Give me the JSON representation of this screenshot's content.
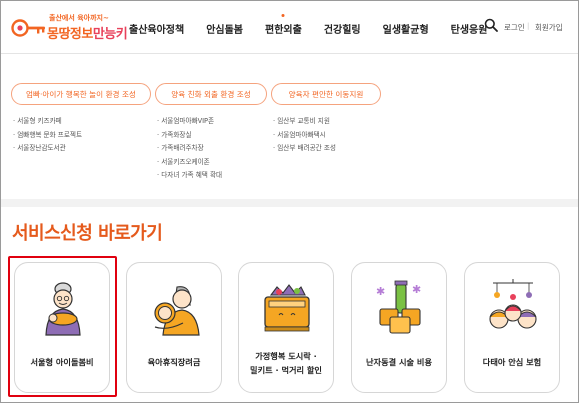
{
  "header": {
    "logo_sub": "출산에서 육아까지~",
    "logo_main_part1": "몽땅정보",
    "logo_main_part2": "만능키",
    "nav": [
      {
        "label": "출산육아정책"
      },
      {
        "label": "안심돌봄"
      },
      {
        "label": "편한외출",
        "active": true
      },
      {
        "label": "건강힐링"
      },
      {
        "label": "일생활균형"
      },
      {
        "label": "탄생응원"
      }
    ],
    "search_icon": "search-icon",
    "login": "로그인",
    "separator": "|",
    "join": "회원가입"
  },
  "mega_menu": {
    "columns": [
      {
        "title": "엄빠·아이가 행복한 놀이 환경 조성",
        "items": [
          "· 서울형 키즈카페",
          "· 엄빠행복 문화 프로젝트",
          "· 서울장난감도서관"
        ]
      },
      {
        "title": "양육 친화 외출 환경 조성",
        "items": [
          "· 서울엄마아빠VIP존",
          "· 가족화장실",
          "· 가족배려주차장",
          "· 서울키즈오케이존",
          "· 다자녀 가족 혜택 확대"
        ]
      },
      {
        "title": "양육자 편안한 이동지원",
        "items": [
          "· 임산부 교통비 지원",
          "· 서울엄마아빠택시",
          "· 임산부 배려공간 조성"
        ]
      }
    ]
  },
  "services": {
    "title": "서비스신청 바로가기",
    "cards": [
      {
        "label": "서울형 아이돌봄비",
        "icon": "grandmother-with-baby-icon",
        "selected": true
      },
      {
        "label": "육아휴직장려금",
        "icon": "father-holding-baby-icon"
      },
      {
        "label_line1": "가정행복 도시락 ·",
        "label_line2": "밀키트 · 먹거리 할인",
        "icon": "lunchbox-icon"
      },
      {
        "label": "난자동결 시술 비용",
        "icon": "egg-freezing-test-tube-icon"
      },
      {
        "label": "다태아 안심 보험",
        "icon": "multiple-babies-icon"
      }
    ]
  },
  "colors": {
    "brand_orange": "#f26522",
    "title_orange": "#e55a1c",
    "highlight_red": "#e0000f"
  }
}
